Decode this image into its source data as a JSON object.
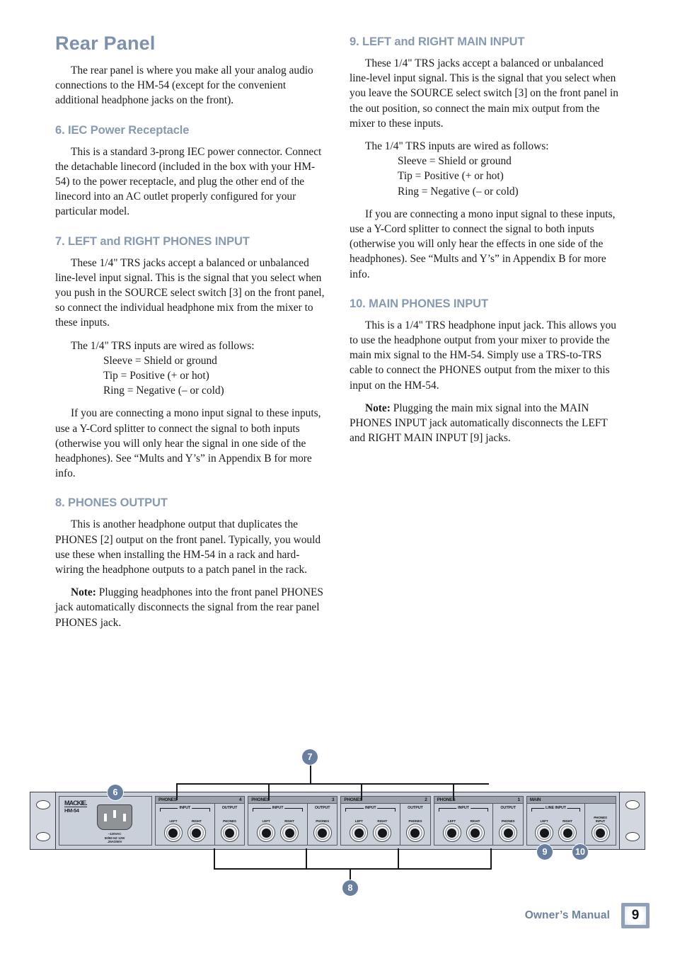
{
  "side_title": "Owner's Manual",
  "page_title": "Rear Panel",
  "left_column": {
    "intro": "The rear panel is where you make all your analog audio connections to the HM-54 (except for the convenient additional headphone jacks on the front).",
    "section6": {
      "heading": "6. IEC Power Receptacle",
      "para1": "This is a standard 3-prong IEC power connector. Connect the detachable linecord (included in the box with your HM-54) to the power receptacle, and plug the other end of the linecord into an AC outlet properly configured for your particular model."
    },
    "section7": {
      "heading": "7. LEFT and RIGHT PHONES INPUT",
      "para1": "These 1/4\" TRS jacks accept a balanced or unbalanced line-level input signal. This is the signal that you select when you push in the SOURCE select switch [3] on the front panel, so connect the individual headphone mix from the mixer to these inputs.",
      "wiring_lead": "The 1/4\" TRS inputs are wired as follows:",
      "wiring": [
        "Sleeve = Shield or ground",
        "Tip = Positive (+ or hot)",
        "Ring = Negative (– or cold)"
      ],
      "para2": "If you are connecting a mono input signal to these inputs, use a Y-Cord splitter to connect the signal to both inputs (otherwise you will only hear the signal in one side of the headphones). See “Mults and Y’s” in Appendix B for more info."
    },
    "section8": {
      "heading": "8. PHONES OUTPUT",
      "para1": "This is another headphone output that duplicates the PHONES [2] output on the front panel. Typically, you would use these when installing the HM-54 in a rack and hard-wiring the headphone outputs to a patch panel in the rack.",
      "note_label": "Note:",
      "note_text": " Plugging headphones into the front panel PHONES jack automatically disconnects the signal from the rear panel PHONES jack."
    }
  },
  "right_column": {
    "section9": {
      "heading": "9. LEFT and RIGHT MAIN INPUT",
      "para1": "These 1/4\" TRS jacks accept a balanced or unbalanced line-level input signal. This is the signal that you select when you leave the SOURCE select switch [3] on the front panel in the out position, so connect the main mix output from the mixer to these inputs.",
      "wiring_lead": "The 1/4\" TRS inputs are wired as follows:",
      "wiring": [
        "Sleeve = Shield or ground",
        "Tip = Positive (+ or hot)",
        "Ring = Negative (– or cold)"
      ],
      "para2": "If you are connecting a mono input signal to these inputs, use a Y-Cord splitter to connect the signal to both inputs (otherwise you will only hear the effects in one side of the headphones). See “Mults and Y’s” in Appendix B for more info."
    },
    "section10": {
      "heading": "10. MAIN PHONES INPUT",
      "para1": "This is a 1/4\" TRS headphone input jack. This allows you to use the headphone output from your mixer to provide the main mix signal to the HM-54. Simply use a TRS-to-TRS cable to connect the PHONES output from the mixer to this input on the HM-54.",
      "note_label": "Note:",
      "note_text": " Plugging the main mix signal into the MAIN PHONES INPUT jack automatically disconnects the LEFT and RIGHT MAIN INPUT [9] jacks."
    }
  },
  "diagram": {
    "brand_logo": "MACKIE.",
    "model": "HM-54",
    "power_label_line1": "~120VAC",
    "power_label_line2": "50/60 HZ 12W",
    "power_label_line3": ".25A/250V",
    "callouts": [
      {
        "id": "callout-6",
        "label": "6"
      },
      {
        "id": "callout-7",
        "label": "7"
      },
      {
        "id": "callout-8",
        "label": "8"
      },
      {
        "id": "callout-9",
        "label": "9"
      },
      {
        "id": "callout-10",
        "label": "10"
      }
    ],
    "channels": [
      {
        "header": "PHONES",
        "number": "4",
        "input_title": "INPUT",
        "left": "LEFT",
        "right": "RIGHT",
        "output_title": "OUTPUT",
        "output_jack": "PHONES"
      },
      {
        "header": "PHONES",
        "number": "3",
        "input_title": "INPUT",
        "left": "LEFT",
        "right": "RIGHT",
        "output_title": "OUTPUT",
        "output_jack": "PHONES"
      },
      {
        "header": "PHONES",
        "number": "2",
        "input_title": "INPUT",
        "left": "LEFT",
        "right": "RIGHT",
        "output_title": "OUTPUT",
        "output_jack": "PHONES"
      },
      {
        "header": "PHONES",
        "number": "1",
        "input_title": "INPUT",
        "left": "LEFT",
        "right": "RIGHT",
        "output_title": "OUTPUT",
        "output_jack": "PHONES"
      }
    ],
    "main": {
      "header": "MAIN",
      "number": "",
      "input_title": "LINE INPUT",
      "left": "LEFT",
      "right": "RIGHT",
      "phones_input_l1": "PHONES",
      "phones_input_l2": "INPUT"
    }
  },
  "footer": {
    "text": "Owner’s Manual",
    "page_number": "9"
  },
  "colors": {
    "heading_blue": "#8799b3",
    "title_blue": "#7d91ad",
    "callout_blue": "#687fa0",
    "panel_gray": "#c9d0da"
  }
}
